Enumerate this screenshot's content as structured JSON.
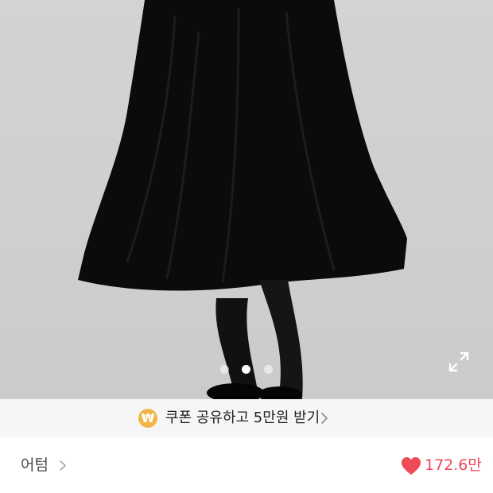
{
  "carousel": {
    "image_subject": "black-midi-skirt-model-photo",
    "slides": [
      "1",
      "2",
      "3"
    ],
    "active_slide": 2,
    "expand_icon": "fullscreen-expand-icon"
  },
  "coupon_banner": {
    "icon": "won-coin-icon",
    "icon_glyph": "₩",
    "text": "쿠폰 공유하고 5만원 받기",
    "chevron_icon": "chevron-right-icon"
  },
  "product_meta": {
    "brand": "어텀",
    "brand_chevron_icon": "chevron-right-icon",
    "like_icon": "heart-icon",
    "like_count": "172.6만"
  },
  "colors": {
    "background": "#cfcfd1",
    "coupon_bg": "#f6f6f6",
    "coin": "#f1b54a",
    "like": "#ee4a58"
  }
}
